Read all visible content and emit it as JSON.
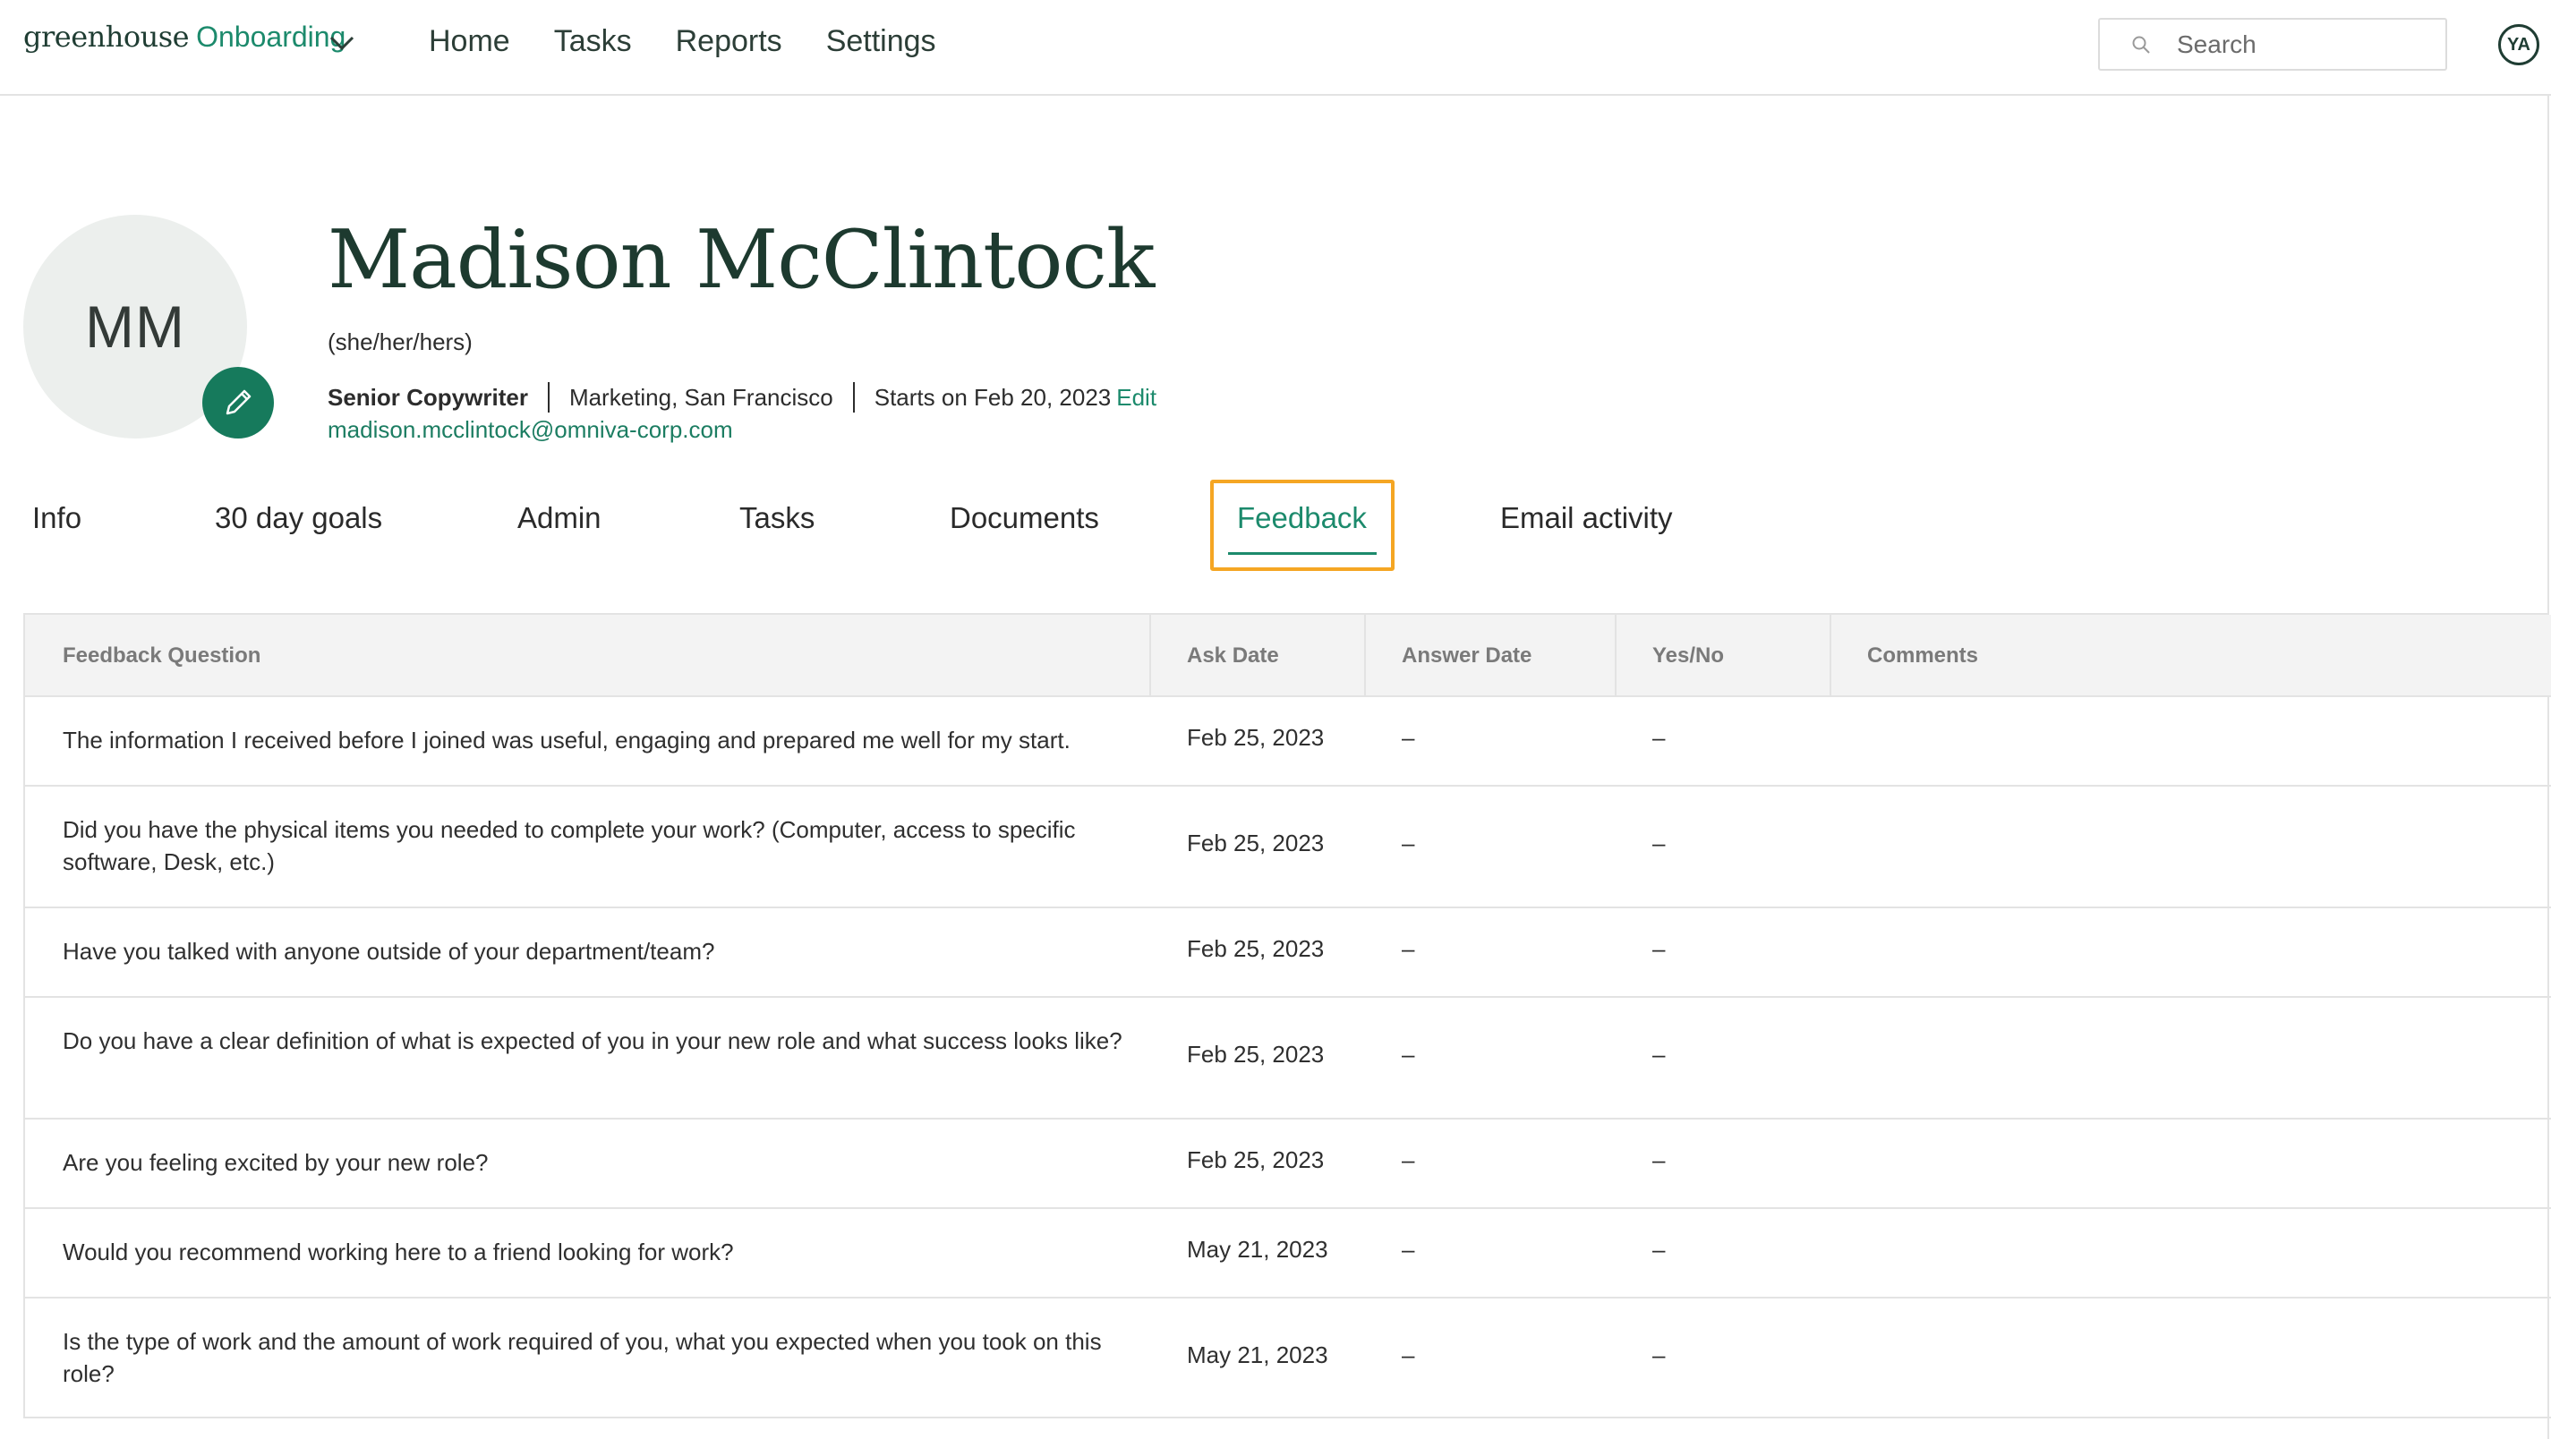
{
  "app": {
    "logo_main": "greenhouse",
    "logo_sub": "Onboarding",
    "nav": [
      "Home",
      "Tasks",
      "Reports",
      "Settings"
    ],
    "search_placeholder": "Search",
    "user_initials": "YA"
  },
  "profile": {
    "initials": "MM",
    "name": "Madison McClintock",
    "pronouns": "(she/her/hers)",
    "title": "Senior Copywriter",
    "department_location": "Marketing, San Francisco",
    "start": "Starts on Feb 20, 2023",
    "edit_label": "Edit",
    "email": "madison.mcclintock@omniva-corp.com"
  },
  "tabs": [
    "Info",
    "30 day goals",
    "Admin",
    "Tasks",
    "Documents",
    "Feedback",
    "Email activity"
  ],
  "active_tab": "Feedback",
  "table": {
    "headers": [
      "Feedback Question",
      "Ask Date",
      "Answer Date",
      "Yes/No",
      "Comments"
    ],
    "rows": [
      {
        "question": "The information I received before I joined was useful, engaging and prepared me well for my start.",
        "ask_date": "Feb 25, 2023",
        "answer_date": "–",
        "yes_no": "–",
        "comments": ""
      },
      {
        "question": "Did you have the physical items you needed to complete your work? (Computer, access to specific software, Desk, etc.)",
        "ask_date": "Feb 25, 2023",
        "answer_date": "–",
        "yes_no": "–",
        "comments": ""
      },
      {
        "question": "Have you talked with anyone outside of your department/team?",
        "ask_date": "Feb 25, 2023",
        "answer_date": "–",
        "yes_no": "–",
        "comments": ""
      },
      {
        "question": "Do you have a clear definition of what is expected of you in your new role and what success looks like?",
        "ask_date": "Feb 25, 2023",
        "answer_date": "–",
        "yes_no": "–",
        "comments": ""
      },
      {
        "question": "Are you feeling excited by your new role?",
        "ask_date": "Feb 25, 2023",
        "answer_date": "–",
        "yes_no": "–",
        "comments": ""
      },
      {
        "question": "Would you recommend working here to a friend looking for work?",
        "ask_date": "May 21, 2023",
        "answer_date": "–",
        "yes_no": "–",
        "comments": ""
      },
      {
        "question": "Is the type of work and the amount of work required of you, what you expected when you took on this role?",
        "ask_date": "May 21, 2023",
        "answer_date": "–",
        "yes_no": "–",
        "comments": ""
      }
    ]
  },
  "colors": {
    "brand_green": "#1c8a6c",
    "dark_green": "#1d3a2f",
    "highlight_orange": "#f5a623"
  }
}
